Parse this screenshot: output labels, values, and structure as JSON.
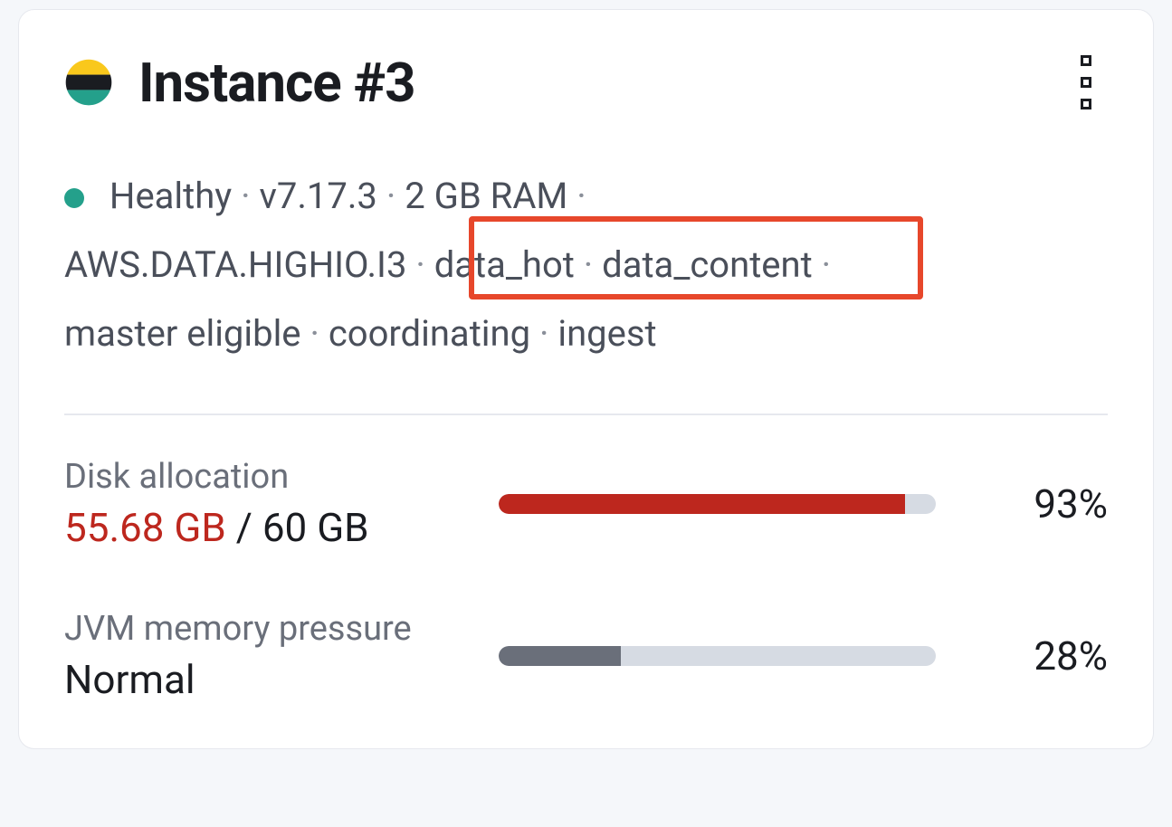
{
  "header": {
    "title": "Instance #3"
  },
  "status": {
    "health": "Healthy",
    "health_color": "#24a08b",
    "version": "v7.17.3",
    "ram": "2 GB RAM",
    "instance_type": "AWS.DATA.HIGHIO.I3",
    "tags": [
      "data_hot",
      "data_content"
    ],
    "roles": [
      "master eligible",
      "coordinating",
      "ingest"
    ]
  },
  "metrics": {
    "disk": {
      "label": "Disk allocation",
      "used": "55.68 GB",
      "total": "60 GB",
      "percent": 93,
      "percent_text": "93%",
      "bar_color": "#bd271e",
      "used_color": "#bd271e"
    },
    "jvm": {
      "label": "JVM memory pressure",
      "status": "Normal",
      "percent": 28,
      "percent_text": "28%",
      "bar_color": "#6a6f7a"
    }
  },
  "colors": {
    "highlight": "#e7472b"
  }
}
